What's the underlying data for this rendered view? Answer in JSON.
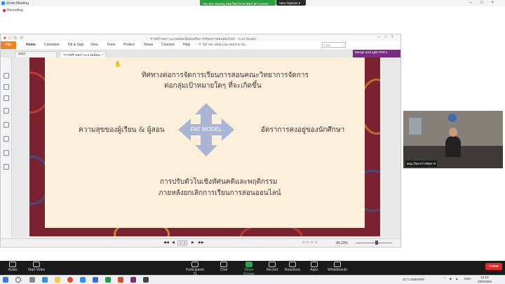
{
  "zoom": {
    "window_title": "Zoom Meeting",
    "share_banner": "You are viewing หอมวิทยาลาลาลัยภาคฯ screen",
    "view_options": "View Options",
    "recording": "Recording"
  },
  "foxit": {
    "title": "\"การสร้างสภาวะแวดล้อมเพื่อส่งเสริมการเรียนการสอนออนไลน์\" - Foxit Reader",
    "menu": [
      "File",
      "Home",
      "Comment",
      "Fill & Sign",
      "View",
      "Form",
      "Protect",
      "Share",
      "Connect",
      "Help"
    ],
    "tell_me": "Tell me what you want to do...",
    "find_placeholder": "Find",
    "tabs": [
      "Start",
      "\"การสร้างสภาวะแวดล้อม...\""
    ],
    "merge_button": "Merge and split PDFs",
    "page_indicator": "4 / 4",
    "zoom_level": "94.23%"
  },
  "slide": {
    "top_line1": "ทิศทางต่อการจัดการเรียนการสอนคณะวิทยาการจัดการ",
    "top_line2": "ต่อกลุ่มเป้าหมายใดๆ ที่จะเกิดขึ้น",
    "left_text": "ความสุขของผู้เรียน & ผู้สอน",
    "right_text": "อัตราการคงอยู่ของนักศึกษา",
    "center_label": "FAT MODEL",
    "bottom_line1": "การปรับตัวในเชิงทัศนคติและพฤติกรรม",
    "bottom_line2": "ภายหลังยกเลิกการเรียนการสอนออนไลน์"
  },
  "video": {
    "participant_name": "คณะวิทยาการจัดการ"
  },
  "toolbar": {
    "audio": "Audio",
    "start_video": "Start Video",
    "participants": "Participants",
    "participants_count": "71",
    "chat": "Chat",
    "share_screen": "Share Screen",
    "record": "Record",
    "reactions": "Reactions",
    "apps": "Apps",
    "whiteboards": "Whiteboards",
    "leave": "Leave"
  },
  "taskbar": {
    "weather": "32°C ฝนตกหนัก",
    "lang": "ENG",
    "time": "13:24",
    "date": "28/6/2565"
  },
  "colors": {
    "foxit_orange": "#f58220",
    "merge_purple": "#7a2b84",
    "zoom_green": "#2e9e3e",
    "leave_red": "#e02828",
    "slide_bg": "#fcf0da",
    "fat_arrow": "#aab5d6"
  }
}
